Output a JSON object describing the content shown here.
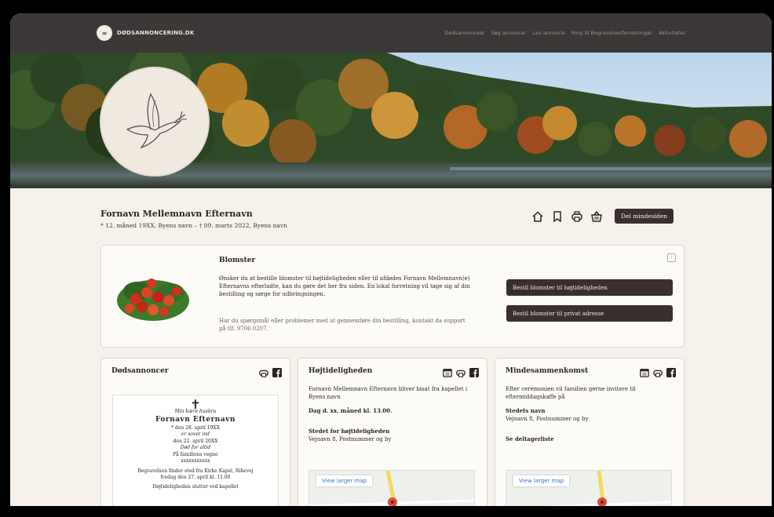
{
  "header": {
    "logo_mark": "∞",
    "site_name": "DØDSANNONCERING.DK",
    "nav": [
      "Dødsannonceer",
      "Søg annoncer",
      "Lav annonce",
      "Ring til Begravelsesforretninger",
      "Aktiviteter"
    ]
  },
  "profile": {
    "name": "Fornavn Mellemnavn Efternavn",
    "dates": "* 12. måned 19XX, Byens navn  –  † 09. marts 2022, Byens navn",
    "share_label": "Del mindesiden"
  },
  "flowers": {
    "title": "Blomster",
    "text": "Ønsker du at bestille blomster til højtideligheden eller til afdødes Fornavn Mellemnavn(e) Efternavns efterladte, kan du gøre det her fra siden. En lokal forretning vil tage sig af din bestilling og sørge for udbringningen.",
    "help": "Har du spørgsmål eller problemer med at gennemføre din bestilling, kontakt da support på tlf. 9706 0207.",
    "button_ceremony": "Bestil blomster til højtideligheden",
    "button_private": "Bestil blomster til privat adresse",
    "info_icon": "i"
  },
  "notices": {
    "title": "Dødsannoncer",
    "card": {
      "cross": "✝",
      "lead": "Min kære husbru",
      "name": "Fornavn  Efternavn",
      "born": "* den 28. april 19XX",
      "sub": "er sovet ind",
      "died": "den 22. april 20XX",
      "l1": "Død for altid",
      "l2": "På familiens vegne",
      "l3": "xxxxxxxxxxx",
      "l4": "Begravelsen finder sted fra Kirke Kapel, Ribevej",
      "l5": "fredag den 27. april kl. 11.00",
      "l6": "Højtideligheden slutter ved kapellet"
    }
  },
  "ceremony": {
    "title": "Højtideligheden",
    "intro": "Fornavn Mellemnavn Efternavn bliver bisat fra kapellet i Byens navn",
    "time": "Dag d. xx. måned kl. 13.00.",
    "place_label": "Stedet for højtideligheden",
    "place_address": "Vejnavn 8, Postnummer og by",
    "map_link": "View larger map"
  },
  "memorial": {
    "title": "Mindesammenkomst",
    "intro": "Efter ceremonien vil familien gerne invitere til eftermiddagskaffe på",
    "place_label": "Stedets navn",
    "place_address": "Vejnavn 8, Postnummer og by",
    "participants": "Se deltagerliste",
    "map_link": "View larger map"
  },
  "colors": {
    "topbar": "#3b3837",
    "button": "#3b2f2e",
    "background": "#f6f2eb"
  }
}
